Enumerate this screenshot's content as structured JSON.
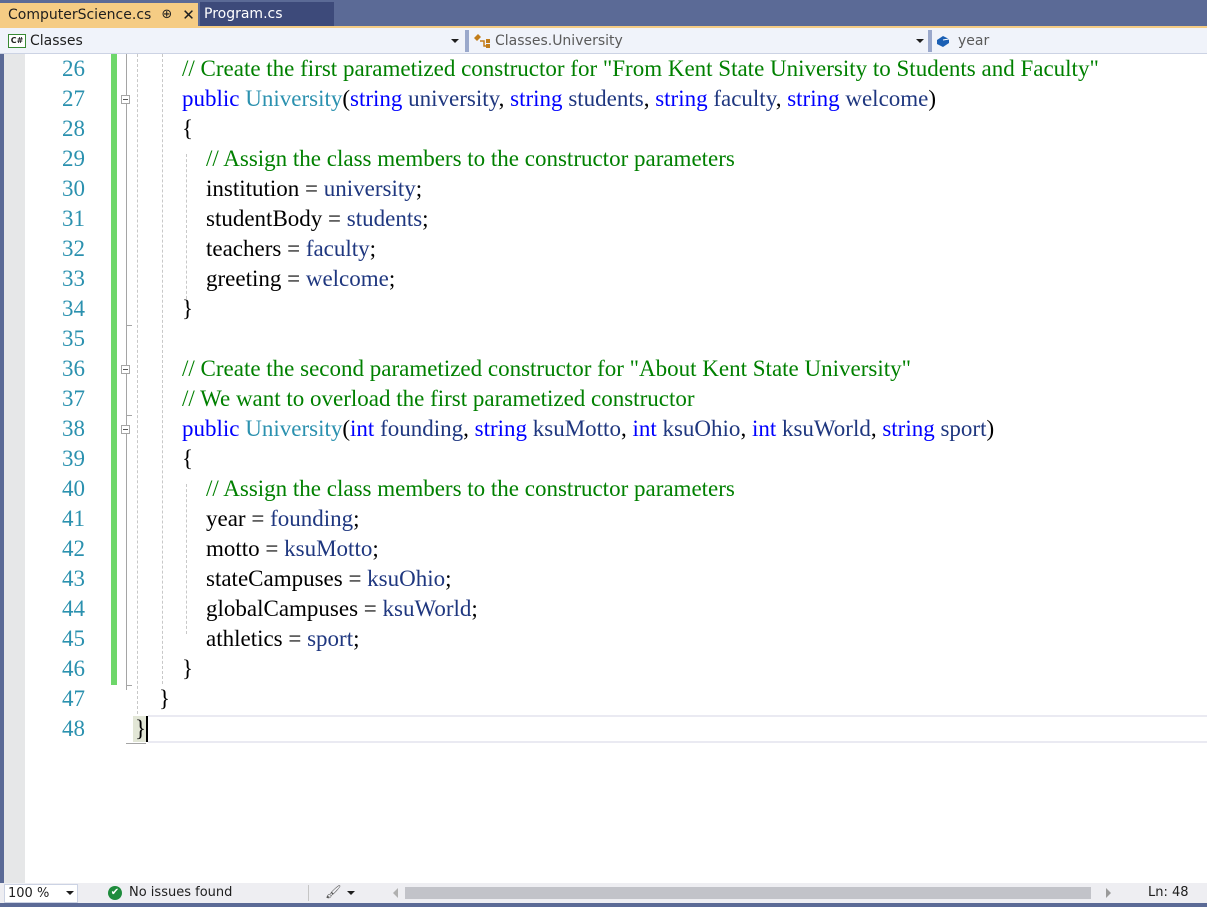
{
  "tabs": [
    {
      "label": "ComputerScience.cs",
      "active": true,
      "pin_icon": "pin-icon",
      "close_icon": "close-icon"
    },
    {
      "label": "Program.cs",
      "active": false
    }
  ],
  "navbar": {
    "project": {
      "label": "Classes",
      "icon": "csharp-project-icon"
    },
    "type": {
      "label": "Classes.University",
      "icon": "class-icon"
    },
    "member": {
      "label": "year",
      "icon": "field-icon"
    }
  },
  "editor": {
    "lines": [
      {
        "num": "26",
        "indent": 1,
        "tokens": [
          {
            "t": "// Create the first parametized constructor for \"From Kent State University to Students and Faculty\"",
            "c": "cm"
          }
        ]
      },
      {
        "num": "27",
        "indent": 1,
        "tokens": [
          {
            "t": "public",
            "c": "kw"
          },
          {
            "t": " ",
            "c": "tx"
          },
          {
            "t": "University",
            "c": "ty"
          },
          {
            "t": "(",
            "c": "tx"
          },
          {
            "t": "string",
            "c": "kw"
          },
          {
            "t": " university",
            "c": "pm"
          },
          {
            "t": ", ",
            "c": "tx"
          },
          {
            "t": "string",
            "c": "kw"
          },
          {
            "t": " students",
            "c": "pm"
          },
          {
            "t": ", ",
            "c": "tx"
          },
          {
            "t": "string",
            "c": "kw"
          },
          {
            "t": " faculty",
            "c": "pm"
          },
          {
            "t": ", ",
            "c": "tx"
          },
          {
            "t": "string",
            "c": "kw"
          },
          {
            "t": " welcome",
            "c": "pm"
          },
          {
            "t": ")",
            "c": "tx"
          }
        ]
      },
      {
        "num": "28",
        "indent": 1,
        "tokens": [
          {
            "t": "{",
            "c": "tx"
          }
        ]
      },
      {
        "num": "29",
        "indent": 2,
        "tokens": [
          {
            "t": "// Assign the class members to the constructor parameters",
            "c": "cm"
          }
        ]
      },
      {
        "num": "30",
        "indent": 2,
        "tokens": [
          {
            "t": "institution = ",
            "c": "tx"
          },
          {
            "t": "university",
            "c": "pm"
          },
          {
            "t": ";",
            "c": "tx"
          }
        ]
      },
      {
        "num": "31",
        "indent": 2,
        "tokens": [
          {
            "t": "studentBody = ",
            "c": "tx"
          },
          {
            "t": "students",
            "c": "pm"
          },
          {
            "t": ";",
            "c": "tx"
          }
        ]
      },
      {
        "num": "32",
        "indent": 2,
        "tokens": [
          {
            "t": "teachers = ",
            "c": "tx"
          },
          {
            "t": "faculty",
            "c": "pm"
          },
          {
            "t": ";",
            "c": "tx"
          }
        ]
      },
      {
        "num": "33",
        "indent": 2,
        "tokens": [
          {
            "t": "greeting = ",
            "c": "tx"
          },
          {
            "t": "welcome",
            "c": "pm"
          },
          {
            "t": ";",
            "c": "tx"
          }
        ]
      },
      {
        "num": "34",
        "indent": 1,
        "tokens": [
          {
            "t": "}",
            "c": "tx"
          }
        ]
      },
      {
        "num": "35",
        "indent": 1,
        "tokens": []
      },
      {
        "num": "36",
        "indent": 1,
        "tokens": [
          {
            "t": "// Create the second parametized constructor for \"About Kent State University\"",
            "c": "cm"
          }
        ]
      },
      {
        "num": "37",
        "indent": 1,
        "tokens": [
          {
            "t": "// We want to overload the first parametized constructor",
            "c": "cm"
          }
        ]
      },
      {
        "num": "38",
        "indent": 1,
        "tokens": [
          {
            "t": "public",
            "c": "kw"
          },
          {
            "t": " ",
            "c": "tx"
          },
          {
            "t": "University",
            "c": "ty"
          },
          {
            "t": "(",
            "c": "tx"
          },
          {
            "t": "int",
            "c": "kw"
          },
          {
            "t": " founding",
            "c": "pm"
          },
          {
            "t": ", ",
            "c": "tx"
          },
          {
            "t": "string",
            "c": "kw"
          },
          {
            "t": " ksuMotto",
            "c": "pm"
          },
          {
            "t": ", ",
            "c": "tx"
          },
          {
            "t": "int",
            "c": "kw"
          },
          {
            "t": " ksuOhio",
            "c": "pm"
          },
          {
            "t": ", ",
            "c": "tx"
          },
          {
            "t": "int",
            "c": "kw"
          },
          {
            "t": " ksuWorld",
            "c": "pm"
          },
          {
            "t": ", ",
            "c": "tx"
          },
          {
            "t": "string",
            "c": "kw"
          },
          {
            "t": " sport",
            "c": "pm"
          },
          {
            "t": ")",
            "c": "tx"
          }
        ]
      },
      {
        "num": "39",
        "indent": 1,
        "tokens": [
          {
            "t": "{",
            "c": "tx"
          }
        ]
      },
      {
        "num": "40",
        "indent": 2,
        "tokens": [
          {
            "t": "// Assign the class members to the constructor parameters",
            "c": "cm"
          }
        ]
      },
      {
        "num": "41",
        "indent": 2,
        "tokens": [
          {
            "t": "year = ",
            "c": "tx"
          },
          {
            "t": "founding",
            "c": "pm"
          },
          {
            "t": ";",
            "c": "tx"
          }
        ]
      },
      {
        "num": "42",
        "indent": 2,
        "tokens": [
          {
            "t": "motto = ",
            "c": "tx"
          },
          {
            "t": "ksuMotto",
            "c": "pm"
          },
          {
            "t": ";",
            "c": "tx"
          }
        ]
      },
      {
        "num": "43",
        "indent": 2,
        "tokens": [
          {
            "t": "stateCampuses = ",
            "c": "tx"
          },
          {
            "t": "ksuOhio",
            "c": "pm"
          },
          {
            "t": ";",
            "c": "tx"
          }
        ]
      },
      {
        "num": "44",
        "indent": 2,
        "tokens": [
          {
            "t": "globalCampuses = ",
            "c": "tx"
          },
          {
            "t": "ksuWorld",
            "c": "pm"
          },
          {
            "t": ";",
            "c": "tx"
          }
        ]
      },
      {
        "num": "45",
        "indent": 2,
        "tokens": [
          {
            "t": "athletics = ",
            "c": "tx"
          },
          {
            "t": "sport",
            "c": "pm"
          },
          {
            "t": ";",
            "c": "tx"
          }
        ]
      },
      {
        "num": "46",
        "indent": 1,
        "tokens": [
          {
            "t": "}",
            "c": "tx"
          }
        ]
      },
      {
        "num": "47",
        "indent": 0,
        "tokens": [
          {
            "t": "}",
            "c": "tx"
          }
        ]
      },
      {
        "num": "48",
        "indent": -1,
        "tokens": [
          {
            "t": "}",
            "c": "tx"
          }
        ]
      }
    ]
  },
  "status": {
    "zoom": "100 %",
    "issues": "No issues found",
    "issues_icon": "check-circle-icon",
    "cleanup_icon": "brush-icon",
    "line": "Ln: 48"
  },
  "colors": {
    "keyword": "#0000ff",
    "type": "#2b91af",
    "comment": "#008000",
    "parameter": "#1f377f",
    "line_number": "#2b91af",
    "change_bar": "#6ed76a",
    "active_tab": "#f5cc84",
    "chrome": "#5b6a96"
  }
}
